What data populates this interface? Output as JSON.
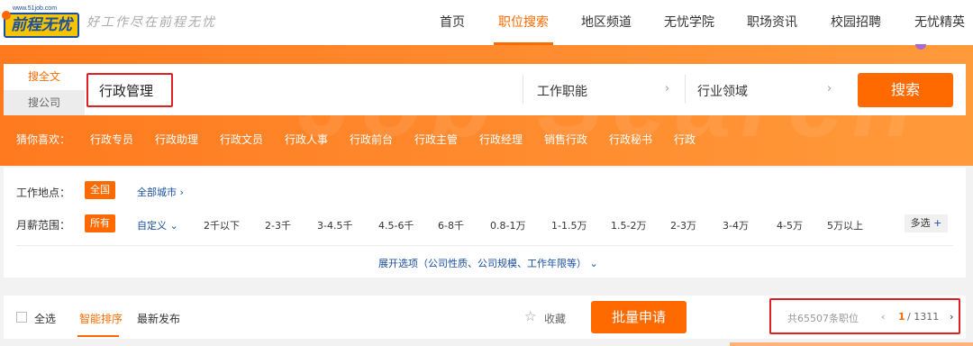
{
  "header": {
    "logo_url_text": "www.51job.com",
    "logo_text": "前程无忧",
    "slogan": "好工作尽在前程无忧",
    "nav": [
      "首页",
      "职位搜索",
      "地区频道",
      "无忧学院",
      "职场资讯",
      "校园招聘",
      "无忧精英"
    ],
    "active_nav": "职位搜索"
  },
  "search": {
    "tab_fulltext": "搜全文",
    "tab_company": "搜公司",
    "keyword": "行政管理",
    "job_function": "工作职能",
    "industry": "行业领域",
    "button": "搜索"
  },
  "guess": {
    "label": "猜你喜欢：",
    "items": [
      "行政专员",
      "行政助理",
      "行政文员",
      "行政人事",
      "行政前台",
      "行政主管",
      "行政经理",
      "销售行政",
      "行政秘书",
      "行政"
    ]
  },
  "filters": {
    "location_label": "工作地点：",
    "location_selected": "全国",
    "all_cities": "全部城市",
    "salary_label": "月薪范围：",
    "salary_selected": "所有",
    "custom": "自定义",
    "salary_options": [
      "2千以下",
      "2-3千",
      "3-4.5千",
      "4.5-6千",
      "6-8千",
      "0.8-1万",
      "1-1.5万",
      "1.5-2万",
      "2-3万",
      "3-4万",
      "4-5万",
      "5万以上"
    ],
    "multi_select": "多选",
    "expand": "展开选项（公司性质、公司规模、工作年限等）"
  },
  "results": {
    "select_all": "全选",
    "sort_smart": "智能排序",
    "sort_latest": "最新发布",
    "favorite": "收藏",
    "batch_apply": "批量申请",
    "total": "共65507条职位",
    "page_current": "1",
    "page_total": "/ 1311"
  },
  "colors": {
    "accent": "#ff6a00",
    "highlight_border": "#e02020",
    "link": "#1a4fa0"
  }
}
